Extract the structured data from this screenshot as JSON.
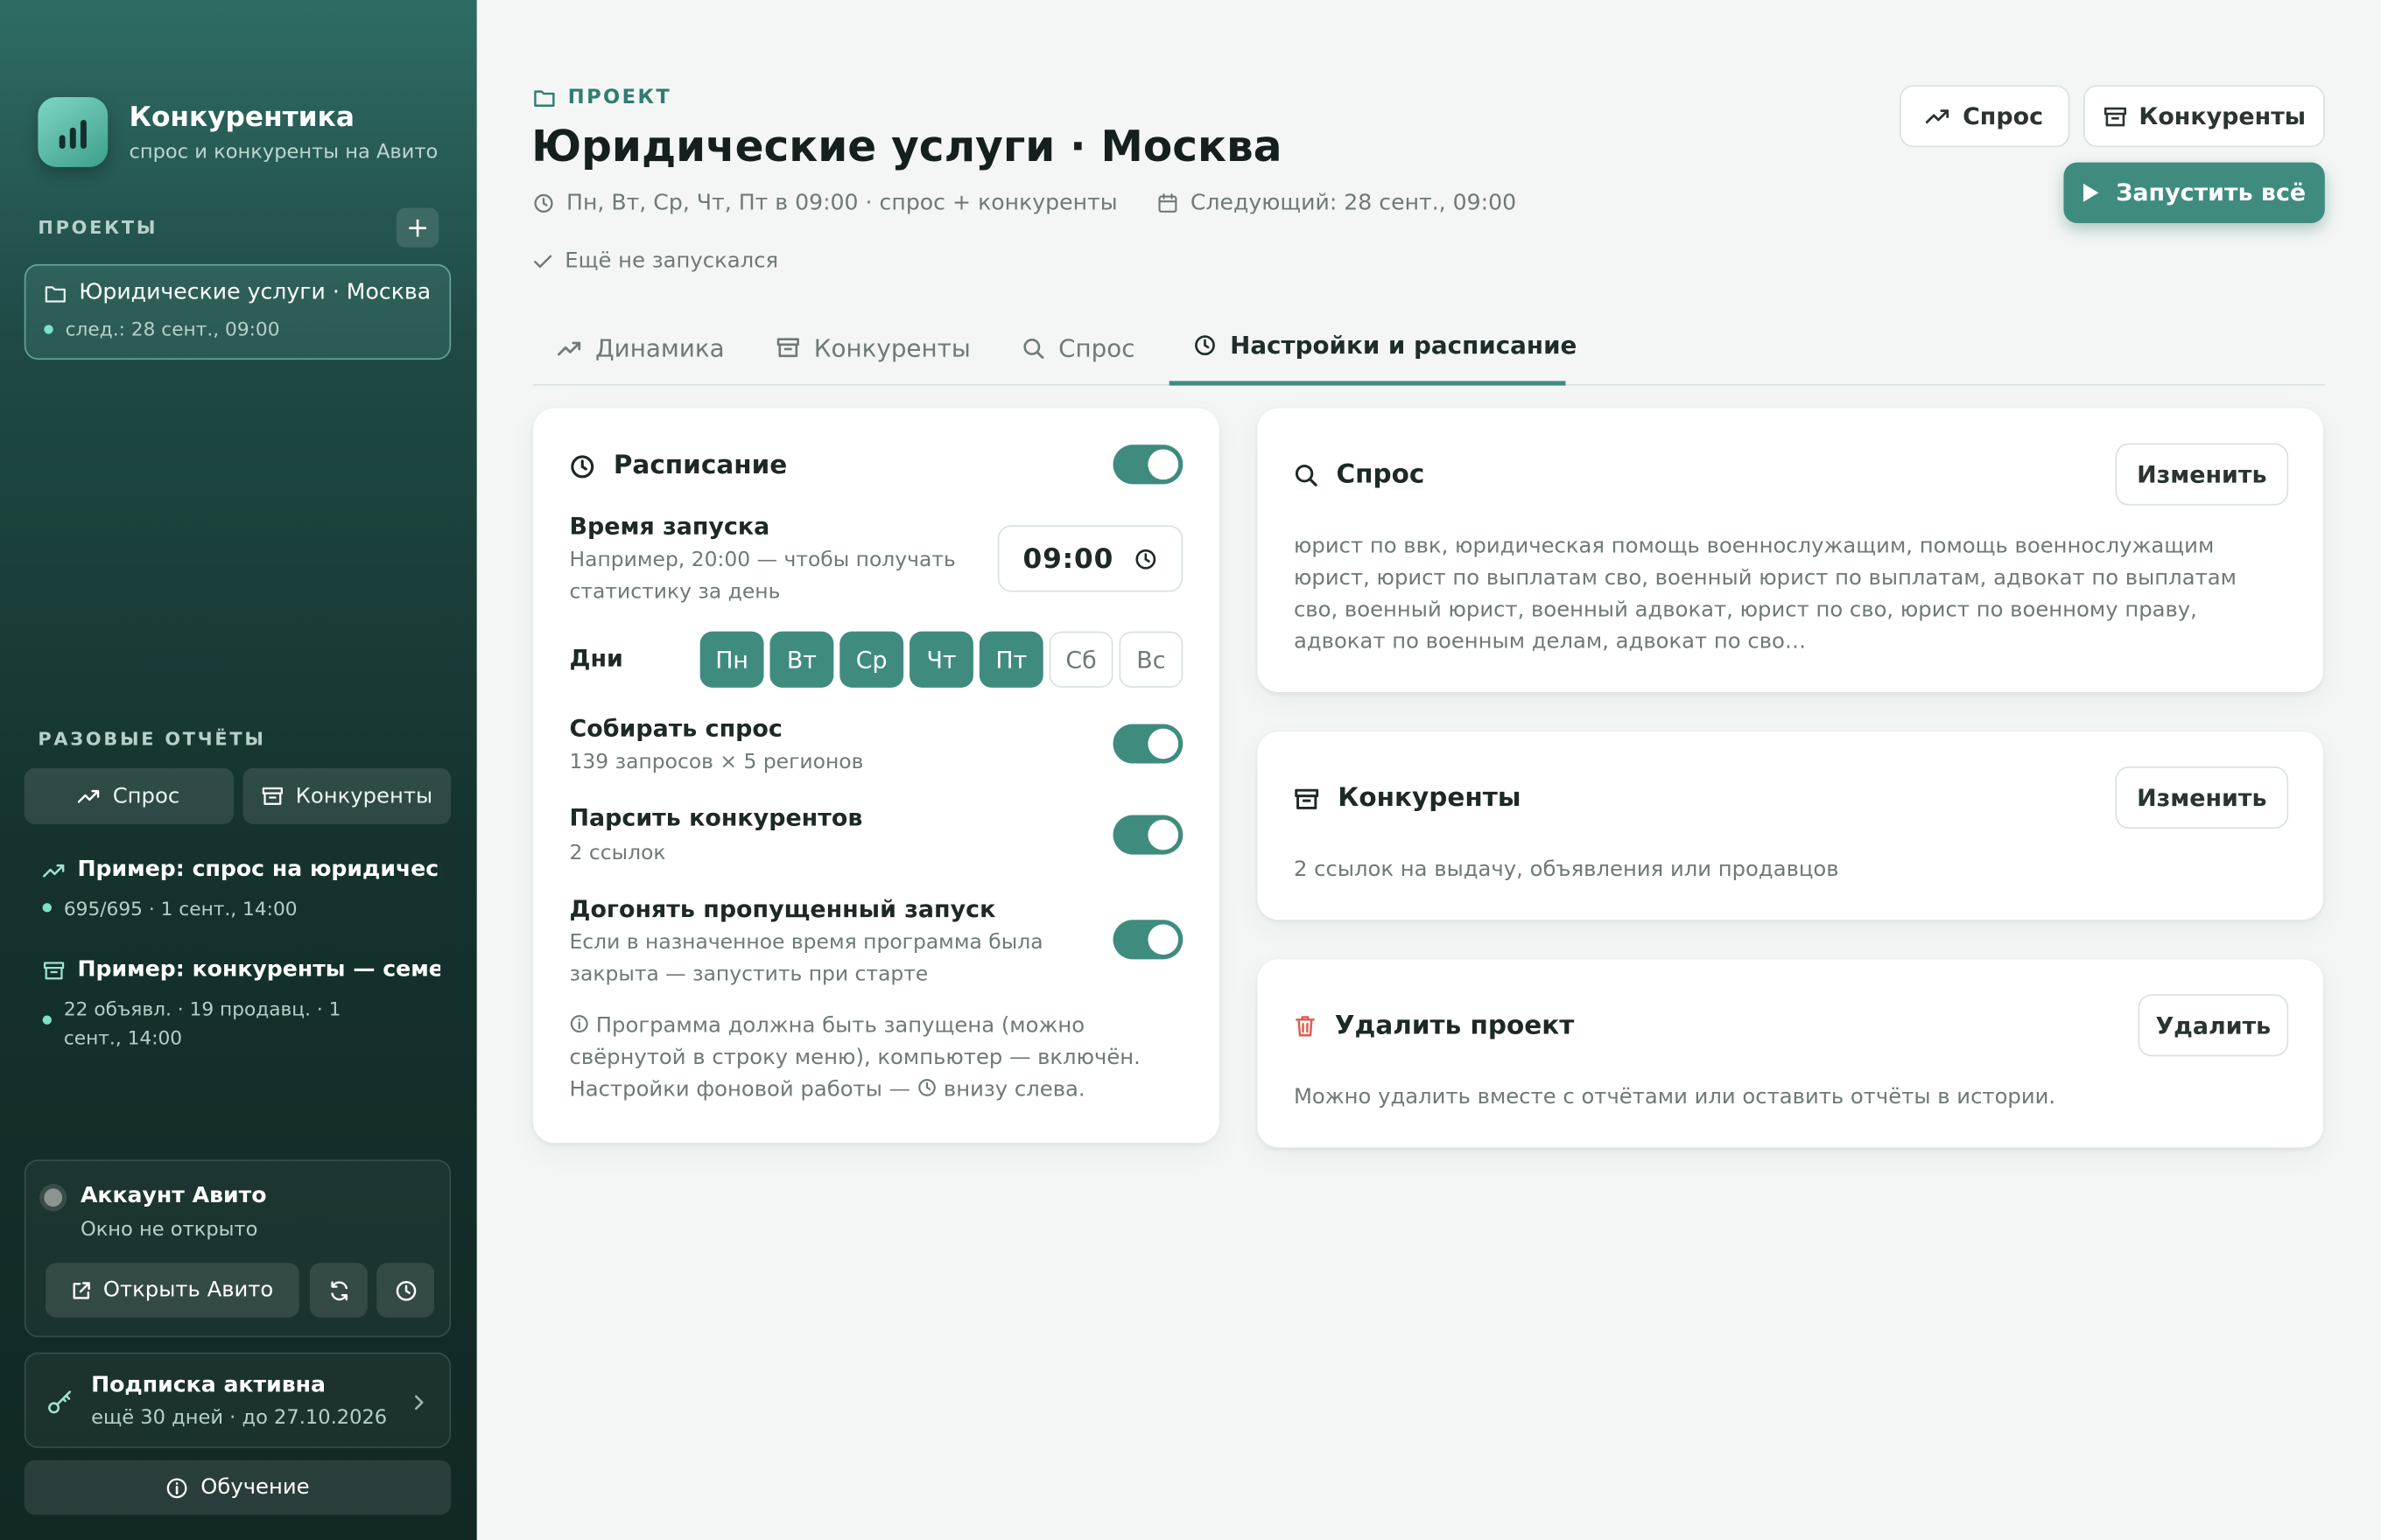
{
  "sidebar": {
    "app_title": "Конкурентика",
    "app_subtitle": "спрос и конкуренты на Авито",
    "projects_title": "ПРОЕКТЫ",
    "add_label": "+",
    "project": {
      "name": "Юридические услуги · Москва",
      "next": "след.: 28 сент., 09:00"
    },
    "reports_title": "РАЗОВЫЕ ОТЧЁТЫ",
    "report_demand_btn": "Спрос",
    "report_competitors_btn": "Конкуренты",
    "reports": [
      {
        "title": "Пример: спрос на юридические",
        "meta": "695/695 · 1 сент., 14:00",
        "icon": "trend-icon"
      },
      {
        "title": "Пример: конкуренты — семейн",
        "meta": "22 объявл. · 19 продавц. · 1 сент., 14:00",
        "icon": "store-icon"
      }
    ],
    "account": {
      "title": "Аккаунт Авито",
      "status": "Окно не открыто",
      "open_label": "Открыть Авито"
    },
    "subscription": {
      "title": "Подписка активна",
      "meta": "ещё 30 дней · до 27.10.2026"
    },
    "learn_label": "Обучение"
  },
  "header": {
    "crumb": "ПРОЕКТ",
    "title": "Юридические услуги · Москва",
    "schedule_summary": "Пн, Вт, Ср, Чт, Пт в 09:00 · спрос + конкуренты",
    "next_run": "Следующий: 28 сент., 09:00",
    "status": "Ещё не запускался",
    "btn_demand": "Спрос",
    "btn_competitors": "Конкуренты",
    "btn_run_all": "Запустить всё"
  },
  "tabs": [
    {
      "label": "Динамика",
      "icon": "trend-icon"
    },
    {
      "label": "Конкуренты",
      "icon": "store-icon"
    },
    {
      "label": "Спрос",
      "icon": "search-icon"
    },
    {
      "label": "Настройки и расписание",
      "icon": "clock-icon",
      "active": true
    }
  ],
  "schedule": {
    "title": "Расписание",
    "enabled": true,
    "time_label": "Время запуска",
    "time_hint": "Например, 20:00 — чтобы получать статистику за день",
    "time_value": "09:00",
    "days_label": "Дни",
    "days": [
      {
        "label": "Пн",
        "on": true
      },
      {
        "label": "Вт",
        "on": true
      },
      {
        "label": "Ср",
        "on": true
      },
      {
        "label": "Чт",
        "on": true
      },
      {
        "label": "Пт",
        "on": true
      },
      {
        "label": "Сб",
        "on": false
      },
      {
        "label": "Вс",
        "on": false
      }
    ],
    "collect_demand_label": "Собирать спрос",
    "collect_demand_sub": "139 запросов × 5 регионов",
    "parse_label": "Парсить конкурентов",
    "parse_sub": "2 ссылок",
    "catchup_label": "Догонять пропущенный запуск",
    "catchup_sub": "Если в назначенное время программа была закрыта — запустить при старте",
    "note_part1": "Программа должна быть запущена (можно свёрнутой в строку меню), компьютер — включён. Настройки фоновой работы —",
    "note_part2": "внизу слева."
  },
  "demand_card": {
    "title": "Спрос",
    "edit_label": "Изменить",
    "body": "юрист по ввк, юридическая помощь военнослужащим, помощь военнослужащим юрист, юрист по выплатам сво, военный юрист по выплатам, адвокат по выплатам сво, военный юрист, военный адвокат, юрист по сво, юрист по военному праву, адвокат по военным делам, адвокат по сво…"
  },
  "competitors_card": {
    "title": "Конкуренты",
    "edit_label": "Изменить",
    "body": "2 ссылок на выдачу, объявления или продавцов"
  },
  "delete_card": {
    "title": "Удалить проект",
    "delete_label": "Удалить",
    "body": "Можно удалить вместе с отчётами или оставить отчёты в истории."
  },
  "colors": {
    "accent": "#3f8c7f",
    "sidebar_top": "#2e6c63",
    "sidebar_bottom": "#112825",
    "danger": "#e05a4f"
  }
}
